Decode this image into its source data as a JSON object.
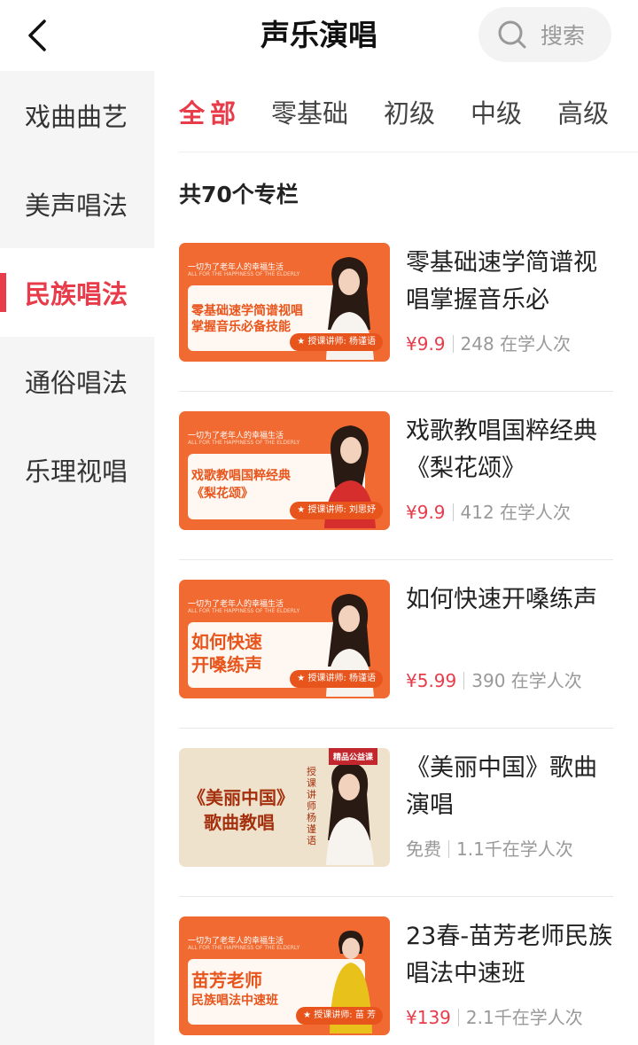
{
  "header": {
    "title": "声乐演唱",
    "search_label": "搜索"
  },
  "sidebar": {
    "items": [
      {
        "label": "戏曲曲艺",
        "active": false
      },
      {
        "label": "美声唱法",
        "active": false
      },
      {
        "label": "民族唱法",
        "active": true
      },
      {
        "label": "通俗唱法",
        "active": false
      },
      {
        "label": "乐理视唱",
        "active": false
      }
    ]
  },
  "tabs": [
    "全部",
    "零基础",
    "初级",
    "中级",
    "高级"
  ],
  "count_text": "共70个专栏",
  "thumb_common": {
    "slogan": "一切为了老年人的幸福生活",
    "slogan_en": "ALL FOR THE HAPPINESS OF THE ELDERLY"
  },
  "courses": [
    {
      "title": "零基础速学简谱视唱掌握音乐必",
      "price": "¥9.9",
      "learners": "248 在学人次",
      "thumb": {
        "style": "orange",
        "line1": "零基础速学简谱视唱",
        "line2": "掌握音乐必备技能",
        "teacher": "★ 授课讲师: 杨谨语"
      }
    },
    {
      "title": "戏歌教唱国粹经典《梨花颂》",
      "price": "¥9.9",
      "learners": "412 在学人次",
      "thumb": {
        "style": "orange",
        "line1": "戏歌教唱国粹经典",
        "line2": "《梨花颂》",
        "teacher": "★ 授课讲师: 刘思妤"
      }
    },
    {
      "title": "如何快速开嗓练声",
      "price": "¥5.99",
      "learners": "390 在学人次",
      "thumb": {
        "style": "orange",
        "line1": "如何快速",
        "line2": "开嗓练声",
        "teacher": "★ 授课讲师: 杨谨语"
      }
    },
    {
      "title": "《美丽中国》歌曲演唱",
      "price": "免费",
      "learners": "1.1千在学人次",
      "thumb": {
        "style": "cream",
        "line1": "《美丽中国》",
        "line2": "歌曲教唱",
        "ribbon": "精品公益课",
        "vertical": "授课讲师杨谨语"
      }
    },
    {
      "title": "23春-苗芳老师民族唱法中速班",
      "price": "¥139",
      "learners": "2.1千在学人次",
      "thumb": {
        "style": "orange",
        "line1": "苗芳老师",
        "line2": "民族唱法中速班",
        "teacher": "★ 授课讲师: 苗 芳"
      }
    }
  ],
  "colors": {
    "accent": "#e83c4b",
    "thumb_orange": "#f06a31",
    "sidebar_bg": "#f5f5f5"
  }
}
